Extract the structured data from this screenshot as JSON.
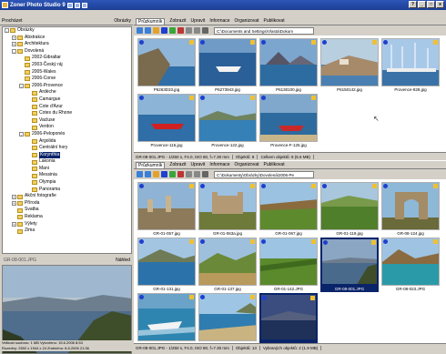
{
  "window": {
    "title": "Zoner Photo Studio 9"
  },
  "left": {
    "header": {
      "label": "Procházet",
      "view": "Obrázky"
    },
    "tree": [
      {
        "label": "Obrázky",
        "depth": 0,
        "exp": "-"
      },
      {
        "label": "Abstrakce",
        "depth": 1,
        "exp": "+"
      },
      {
        "label": "Architektura",
        "depth": 1,
        "exp": "+"
      },
      {
        "label": "Dovolená",
        "depth": 1,
        "exp": "-"
      },
      {
        "label": "2002-Gibraltar",
        "depth": 2,
        "exp": ""
      },
      {
        "label": "2003-Český ráj",
        "depth": 2,
        "exp": ""
      },
      {
        "label": "2005-Wales",
        "depth": 2,
        "exp": ""
      },
      {
        "label": "2006-Corse",
        "depth": 2,
        "exp": ""
      },
      {
        "label": "2006-Provence",
        "depth": 2,
        "exp": "-"
      },
      {
        "label": "Ardèche",
        "depth": 3,
        "exp": ""
      },
      {
        "label": "Camargue",
        "depth": 3,
        "exp": ""
      },
      {
        "label": "Cote d'Azur",
        "depth": 3,
        "exp": ""
      },
      {
        "label": "Cotes du Rhone",
        "depth": 3,
        "exp": ""
      },
      {
        "label": "Vacluse",
        "depth": 3,
        "exp": ""
      },
      {
        "label": "Verdon",
        "depth": 3,
        "exp": ""
      },
      {
        "label": "2006-Peloponés",
        "depth": 2,
        "exp": "-"
      },
      {
        "label": "Argolida",
        "depth": 3,
        "exp": ""
      },
      {
        "label": "Centrální hory",
        "depth": 3,
        "exp": ""
      },
      {
        "label": "Korynthia",
        "depth": 3,
        "exp": "",
        "selected": true
      },
      {
        "label": "Lakonia",
        "depth": 3,
        "exp": ""
      },
      {
        "label": "Mani",
        "depth": 3,
        "exp": ""
      },
      {
        "label": "Messinia",
        "depth": 3,
        "exp": ""
      },
      {
        "label": "Olympia",
        "depth": 3,
        "exp": ""
      },
      {
        "label": "Panorama",
        "depth": 3,
        "exp": ""
      },
      {
        "label": "Akční fotografie",
        "depth": 1,
        "exp": "+"
      },
      {
        "label": "Příroda",
        "depth": 1,
        "exp": "+"
      },
      {
        "label": "Svatba",
        "depth": 1,
        "exp": ""
      },
      {
        "label": "Reklama",
        "depth": 1,
        "exp": ""
      },
      {
        "label": "Výlety",
        "depth": 1,
        "exp": "+"
      },
      {
        "label": "Zima",
        "depth": 1,
        "exp": ""
      }
    ],
    "preview_bar": {
      "file": "GR-08-001.JPG",
      "view": "Náhled"
    },
    "preview_status": {
      "line1": "Velikost souboru: 1 MB     Vytvořeno: 15.6.2006 8:53",
      "line2": "Rozměry: 2592 x 1944 x 24    Změněno: 8.8.2006 21:36"
    }
  },
  "top_pane": {
    "tabs": [
      "Průzkumník",
      "Zobrazit",
      "Upravit",
      "Informace",
      "Organizovat",
      "Publikovat"
    ],
    "address": "C:\\Documents and Settings\\Vlasta\\Dokum",
    "items": [
      {
        "caption": "P6263D33.jpg",
        "scene": "coast"
      },
      {
        "caption": "P6273943.jpg",
        "scene": "boat"
      },
      {
        "caption": "P6130100.jpg",
        "scene": "rocks"
      },
      {
        "caption": "P6150142.jpg",
        "scene": "village"
      },
      {
        "caption": "Provence-828.jpg",
        "scene": "marina"
      },
      {
        "caption": "Provence-115.jpg",
        "scene": "redboat"
      },
      {
        "caption": "Provence-122.jpg",
        "scene": "bay"
      },
      {
        "caption": "Provence-F-125.jpg",
        "scene": "redboat2"
      }
    ],
    "status": {
      "exif": "GR-08-001.JPG - 1/250 s, F4.0, ISO 80, f=7.30 mm",
      "count": "Objektů: 8",
      "size": "Celkem objektů: 8 (5.6 MB)"
    }
  },
  "bottom_pane": {
    "tabs": [
      "Průzkumník",
      "Zobrazit",
      "Upravit",
      "Informace",
      "Organizovat",
      "Publikovat"
    ],
    "address": "C:\\Dokumenty\\Obrázky\\Dovolená\\2006-Pe",
    "items": [
      {
        "caption": "GR-01-057.jpg",
        "scene": "ruins"
      },
      {
        "caption": "GR-01-063a.jpg",
        "scene": "castle"
      },
      {
        "caption": "GR-01-067.jpg",
        "scene": "field"
      },
      {
        "caption": "GR-01-119.jpg",
        "scene": "green"
      },
      {
        "caption": "GR-08-124.jpg",
        "scene": "arch"
      },
      {
        "caption": "GR-01-131.jpg",
        "scene": "sea"
      },
      {
        "caption": "GR-01-137.jpg",
        "scene": "hills"
      },
      {
        "caption": "GR-01-142.JPG",
        "scene": "grove"
      },
      {
        "caption": "GR-08-001.JPG",
        "scene": "sunset",
        "selected": true
      },
      {
        "caption": "GR-08-023.JPG",
        "scene": "lagoon"
      },
      {
        "caption": "GR-08-026.JPG",
        "scene": "speedboat"
      },
      {
        "caption": "GR-08-044.JPG",
        "scene": "shore"
      },
      {
        "caption": "GR-08-052.JPG",
        "scene": "dusk",
        "selected": true
      }
    ],
    "status": {
      "exif": "GR-08-001.JPG - 1/250 s, F4.0, ISO 80, f=7.30 mm",
      "count": "Objektů: 13",
      "size": "Vybraných objektů: 2 (1.9 MB)"
    }
  }
}
